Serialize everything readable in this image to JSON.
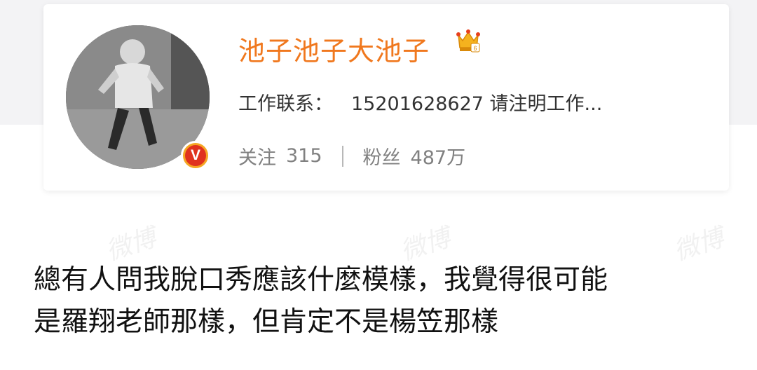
{
  "profile": {
    "username": "池子池子大池子",
    "bio_label": "工作联系：",
    "bio_value": "15201628627 请注明工作...",
    "following_label": "关注",
    "following_count": "315",
    "followers_label": "粉丝",
    "followers_count": "487万",
    "verified_badge": "V",
    "avatar_icon": "avatar-photo",
    "vip_icon": "crown-icon"
  },
  "post": {
    "line1": "總有人問我脫口秀應該什麼模樣，我覺得很可能",
    "line2": "是羅翔老師那樣，但肯定不是楊笠那樣"
  },
  "watermark": {
    "text": "微博"
  },
  "colors": {
    "username": "#f0781e",
    "badge_outer": "#f5a623",
    "badge_inner": "#e0321e",
    "band": "#f3f3f5"
  }
}
